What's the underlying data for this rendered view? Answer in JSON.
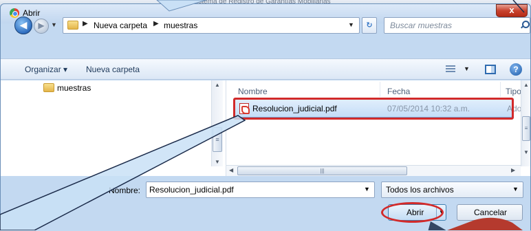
{
  "background": {
    "title": "Sistema de Registro de Garantías Mobiliarias"
  },
  "window": {
    "title": "Abrir",
    "close_label": "x"
  },
  "navigation": {
    "breadcrumbs": [
      "Nueva carpeta",
      "muestras"
    ],
    "search_placeholder": "Buscar muestras"
  },
  "toolbar": {
    "organize_label": "Organizar ▾",
    "new_folder_label": "Nueva carpeta"
  },
  "nav_pane": {
    "items": [
      {
        "label": "muestras",
        "icon": "folder-icon"
      }
    ]
  },
  "file_list": {
    "columns": [
      "Nombre",
      "Fecha",
      "Tipo"
    ],
    "rows": [
      {
        "name": "Resolucion_judicial.pdf",
        "date": "07/05/2014 10:32 a.m.",
        "type": "Ado",
        "icon": "pdf-icon",
        "selected": true
      }
    ]
  },
  "footer": {
    "name_label": "Nombre:",
    "name_value": "Resolucion_judicial.pdf",
    "file_type_filter": "Todos los archivos",
    "open_label": "Abrir",
    "cancel_label": "Cancelar"
  },
  "colors": {
    "highlight": "#d22a2a",
    "callout": "#c9e0f6",
    "arrow_shape": "#b53a2e"
  }
}
